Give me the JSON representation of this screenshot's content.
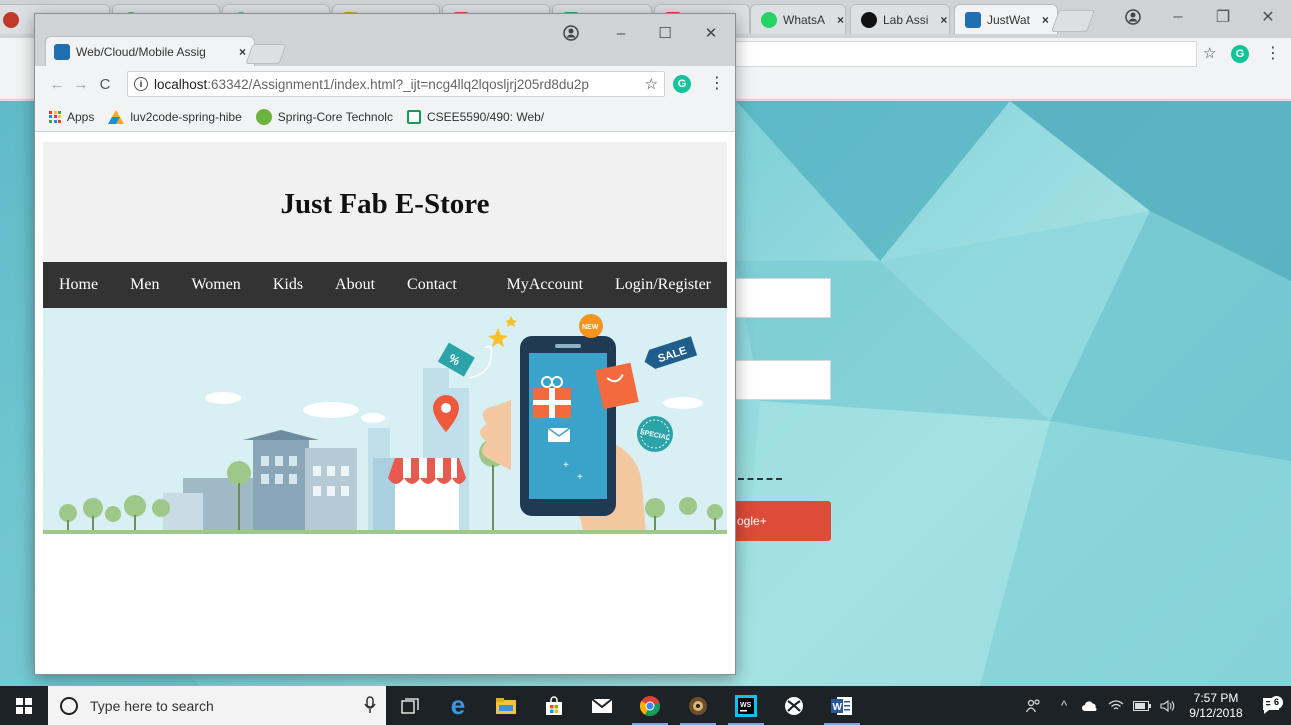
{
  "background_window": {
    "tabs": [
      {
        "label": "",
        "favicon_color": "#c0392b"
      },
      {
        "label": "",
        "favicon_color": "#2ecc71"
      },
      {
        "label": "",
        "favicon_color": "#2ecc71"
      },
      {
        "label": "",
        "favicon_color": "#f39c12"
      },
      {
        "label": "",
        "favicon_color": "#e74c3c"
      },
      {
        "label": "",
        "favicon_color": "#27ae60"
      },
      {
        "label": "",
        "favicon_color": "#e53935"
      },
      {
        "label": "WhatsA",
        "favicon_color": "#25d366"
      },
      {
        "label": "Lab Assi",
        "favicon_color": "#111111"
      },
      {
        "label": "JustWat",
        "favicon_color": "#1f6fb2"
      }
    ],
    "google_button_label": "ogle+"
  },
  "window": {
    "tab_title": "Web/Cloud/Mobile Assig",
    "address": {
      "host": "localhost",
      "path": ":63342/Assignment1/index.html?_ijt=ncg4llq2lqosljrj205rd8du2p"
    },
    "bookmarks": [
      {
        "label": "Apps",
        "icon": "apps-icon"
      },
      {
        "label": "luv2code-spring-hibe",
        "icon": "luv2code-icon"
      },
      {
        "label": "Spring-Core Technolc",
        "icon": "spring-icon"
      },
      {
        "label": "CSEE5590/490: Web/",
        "icon": "sheets-icon"
      }
    ]
  },
  "site": {
    "title": "Just Fab E-Store",
    "nav": [
      "Home",
      "Men",
      "Women",
      "Kids",
      "About",
      "Contact",
      "MyAccount",
      "Login/Register"
    ]
  },
  "banner": {
    "sale_tag": "SALE",
    "special_tag": "SPECIAL",
    "new_tag": "NEW",
    "percent_tag": "%"
  },
  "taskbar": {
    "search_placeholder": "Type here to search",
    "time": "7:57 PM",
    "date": "9/12/2018",
    "notification_count": "6",
    "apps": [
      "task-view-icon",
      "edge-icon",
      "file-explorer-icon",
      "store-icon",
      "mail-icon",
      "chrome-icon",
      "app-icon",
      "webstorm-icon",
      "xbox-icon",
      "word-icon"
    ]
  },
  "colors": {
    "nav_bg": "#333333",
    "header_bg": "#f1f1f1",
    "google_red": "#dd4b39",
    "taskbar": "#1d2226"
  }
}
